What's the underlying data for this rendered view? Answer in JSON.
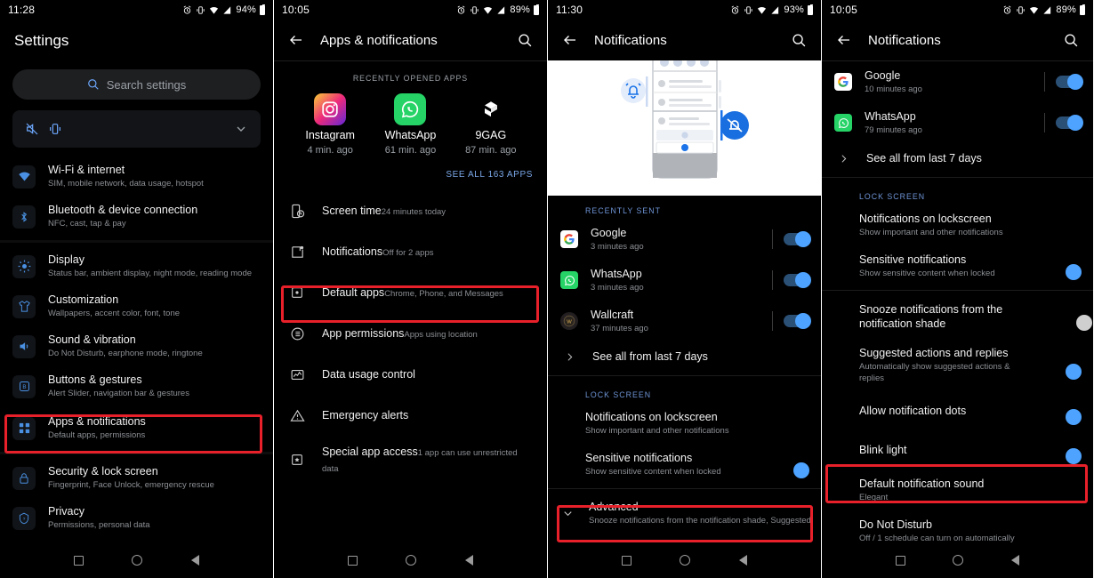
{
  "panels": [
    {
      "id": "settings-home",
      "statusbar": {
        "time": "11:28",
        "battery": "94%"
      },
      "title": "Settings",
      "search": {
        "placeholder": "Search settings"
      },
      "quick_card": {
        "icons": [
          "silent-icon",
          "vibrate-icon"
        ],
        "chevron": "chevron-down-icon"
      },
      "items": [
        {
          "title": "Wi-Fi & internet",
          "subtitle": "SIM, mobile network, data usage, hotspot",
          "icon": "wifi-icon"
        },
        {
          "title": "Bluetooth & device connection",
          "subtitle": "NFC, cast, tap & pay",
          "icon": "bluetooth-icon"
        },
        {
          "title": "Display",
          "subtitle": "Status bar, ambient display, night mode, reading mode",
          "icon": "brightness-icon"
        },
        {
          "title": "Customization",
          "subtitle": "Wallpapers, accent color, font, tone",
          "icon": "shirt-icon"
        },
        {
          "title": "Sound & vibration",
          "subtitle": "Do Not Disturb, earphone mode, ringtone",
          "icon": "speaker-icon"
        },
        {
          "title": "Buttons & gestures",
          "subtitle": "Alert Slider, navigation bar & gestures",
          "icon": "buttons-icon"
        },
        {
          "title": "Apps & notifications",
          "subtitle": "Default apps, permissions",
          "icon": "apps-grid-icon",
          "highlighted": true
        },
        {
          "title": "Security & lock screen",
          "subtitle": "Fingerprint, Face Unlock, emergency rescue",
          "icon": "lock-icon"
        },
        {
          "title": "Privacy",
          "subtitle": "Permissions, personal data",
          "icon": "shield-icon"
        }
      ]
    },
    {
      "id": "apps-notifications",
      "statusbar": {
        "time": "10:05",
        "battery": "89%"
      },
      "toolbar": {
        "back": "back-arrow-icon",
        "title": "Apps & notifications",
        "search": "search-icon"
      },
      "section_label": "RECENTLY OPENED APPS",
      "recent_apps": [
        {
          "name": "Instagram",
          "time": "4 min. ago"
        },
        {
          "name": "WhatsApp",
          "time": "61 min. ago"
        },
        {
          "name": "9GAG",
          "time": "87 min. ago"
        }
      ],
      "see_all": "SEE ALL 163 APPS",
      "items": [
        {
          "title": "Screen time",
          "subtitle": "24 minutes today",
          "icon": "screen-time-icon"
        },
        {
          "title": "Notifications",
          "subtitle": "Off for 2 apps",
          "icon": "notification-icon",
          "highlighted": true
        },
        {
          "title": "Default apps",
          "subtitle": "Chrome, Phone, and Messages",
          "icon": "default-apps-icon"
        },
        {
          "title": "App permissions",
          "subtitle": "Apps using location",
          "icon": "permissions-icon"
        },
        {
          "title": "Data usage control",
          "subtitle": "",
          "icon": "data-usage-icon"
        },
        {
          "title": "Emergency alerts",
          "subtitle": "",
          "icon": "warning-icon"
        },
        {
          "title": "Special app access",
          "subtitle": "1 app can use unrestricted data",
          "icon": "special-access-icon"
        }
      ]
    },
    {
      "id": "notifications-collapsed",
      "statusbar": {
        "time": "11:30",
        "battery": "93%"
      },
      "toolbar": {
        "back": "back-arrow-icon",
        "title": "Notifications",
        "search": "search-icon"
      },
      "recently_sent_label": "RECENTLY SENT",
      "recent": [
        {
          "app": "Google",
          "time": "3 minutes ago",
          "toggle": "on",
          "icon": "google-icon"
        },
        {
          "app": "WhatsApp",
          "time": "3 minutes ago",
          "toggle": "on",
          "icon": "whatsapp-icon"
        },
        {
          "app": "Wallcraft",
          "time": "37 minutes ago",
          "toggle": "on",
          "icon": "wallcraft-icon"
        }
      ],
      "see_all": "See all from last 7 days",
      "lock_screen_label": "LOCK SCREEN",
      "settings": [
        {
          "title": "Notifications on lockscreen",
          "subtitle": "Show important and other notifications",
          "toggle": null
        },
        {
          "title": "Sensitive notifications",
          "subtitle": "Show sensitive content when locked",
          "toggle": "on"
        }
      ],
      "advanced": {
        "title": "Advanced",
        "subtitle": "Snooze notifications from the notification shade, Suggested ac..",
        "chevron": "chevron-down-icon",
        "highlighted": true
      }
    },
    {
      "id": "notifications-expanded",
      "statusbar": {
        "time": "10:05",
        "battery": "89%"
      },
      "toolbar": {
        "back": "back-arrow-icon",
        "title": "Notifications",
        "search": "search-icon"
      },
      "recent": [
        {
          "app": "Google",
          "time": "10 minutes ago",
          "toggle": "on",
          "icon": "google-icon"
        },
        {
          "app": "WhatsApp",
          "time": "79 minutes ago",
          "toggle": "on",
          "icon": "whatsapp-icon"
        }
      ],
      "see_all": "See all from last 7 days",
      "lock_screen_label": "LOCK SCREEN",
      "settings": [
        {
          "title": "Notifications on lockscreen",
          "subtitle": "Show important and other notifications",
          "toggle": null
        },
        {
          "title": "Sensitive notifications",
          "subtitle": "Show sensitive content when locked",
          "toggle": "on"
        },
        {
          "title": "Snooze notifications from the notification shade",
          "subtitle": "",
          "toggle": "off"
        },
        {
          "title": "Suggested actions and replies",
          "subtitle": "Automatically show suggested actions & replies",
          "toggle": "on"
        },
        {
          "title": "Allow notification dots",
          "subtitle": "",
          "toggle": "on"
        },
        {
          "title": "Blink light",
          "subtitle": "",
          "toggle": "on"
        },
        {
          "title": "Default notification sound",
          "subtitle": "Elegant",
          "toggle": null,
          "highlighted": true
        },
        {
          "title": "Do Not Disturb",
          "subtitle": "Off / 1 schedule can turn on automatically",
          "toggle": null
        }
      ]
    }
  ],
  "navbar": {
    "recents": "square-icon",
    "home": "circle-icon",
    "back": "triangle-back-icon"
  },
  "colors": {
    "accent_blue": "#4da3ff",
    "highlight_red": "#e8202a",
    "label_blue": "#6e94d6",
    "link_blue": "#7aa7e8",
    "background": "#000000",
    "secondary_text": "#8b8f94"
  }
}
